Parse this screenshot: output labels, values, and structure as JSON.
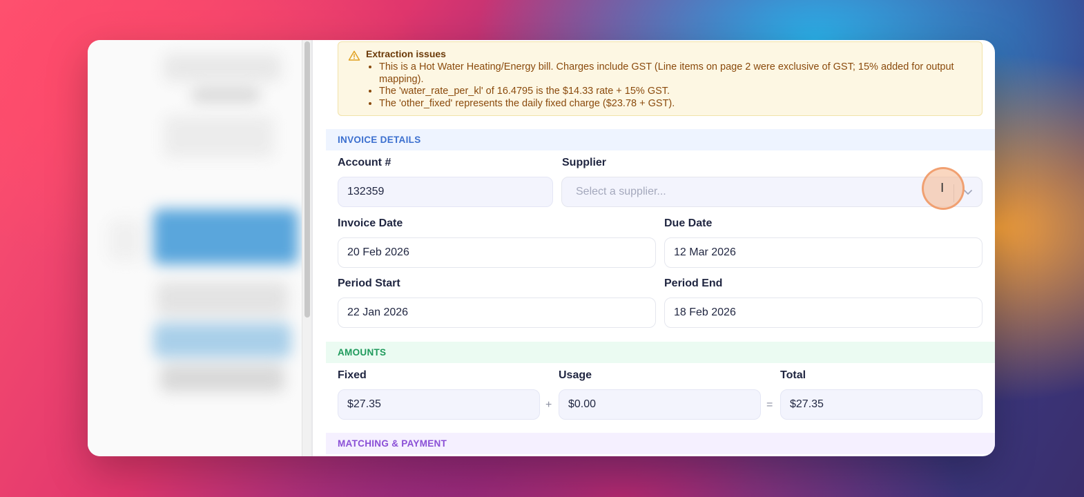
{
  "alert": {
    "title": "Extraction issues",
    "items": [
      "This is a Hot Water Heating/Energy bill. Charges include GST (Line items on page 2 were exclusive of GST; 15% added for output mapping).",
      "The 'water_rate_per_kl' of 16.4795 is the $14.33 rate + 15% GST.",
      "The 'other_fixed' represents the daily fixed charge ($23.78 + GST)."
    ]
  },
  "invoice_details": {
    "heading": "INVOICE DETAILS",
    "account_label": "Account #",
    "account_value": "132359",
    "supplier_label": "Supplier",
    "supplier_placeholder": "Select a supplier...",
    "invoice_date_label": "Invoice Date",
    "invoice_date_value": "20 Feb 2026",
    "due_date_label": "Due Date",
    "due_date_value": "12 Mar 2026",
    "period_start_label": "Period Start",
    "period_start_value": "22 Jan 2026",
    "period_end_label": "Period End",
    "period_end_value": "18 Feb 2026"
  },
  "amounts": {
    "heading": "AMOUNTS",
    "fixed_label": "Fixed",
    "fixed_value": "$27.35",
    "plus": "+",
    "usage_label": "Usage",
    "usage_value": "$0.00",
    "equals": "=",
    "total_label": "Total",
    "total_value": "$27.35"
  },
  "matching": {
    "heading": "MATCHING & PAYMENT"
  },
  "icons": {
    "alert": "warning-triangle-icon",
    "select": "chevron-down-icon",
    "cursor": "text-cursor-icon"
  },
  "colors": {
    "alert_bg": "#fdf7e3",
    "alert_text": "#8a4a0c",
    "invoice_section": "#3b6fcf",
    "amounts_section": "#1f9a5c",
    "matching_section": "#8a4fd6"
  }
}
